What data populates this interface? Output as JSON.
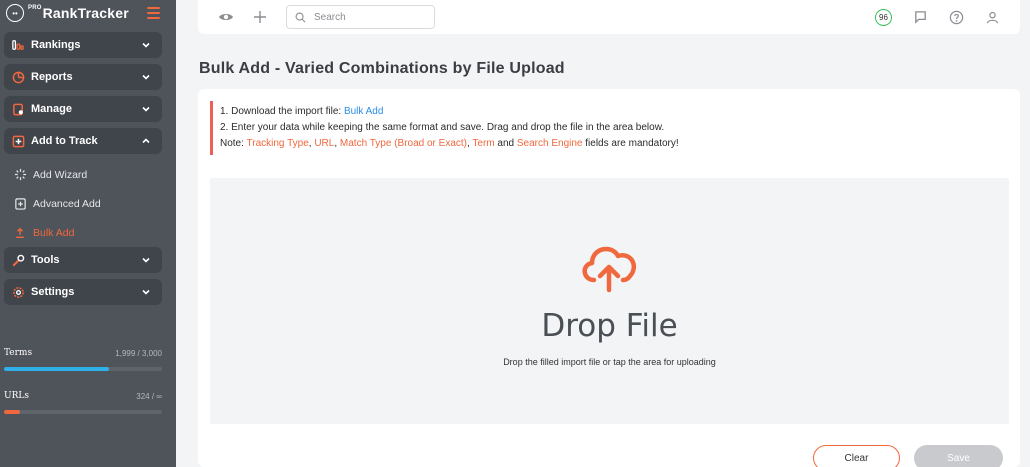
{
  "app": {
    "logo_prefix": "PRO",
    "logo_name": "RankTracker"
  },
  "sidebar": {
    "nav": [
      {
        "label": "Rankings",
        "icon": "rankings-icon"
      },
      {
        "label": "Reports",
        "icon": "pie-chart-icon"
      },
      {
        "label": "Manage",
        "icon": "manage-icon"
      },
      {
        "label": "Add to Track",
        "icon": "add-box-icon"
      }
    ],
    "sub_items": [
      {
        "label": "Add Wizard",
        "icon": "wizard-icon"
      },
      {
        "label": "Advanced Add",
        "icon": "advanced-add-icon"
      },
      {
        "label": "Bulk Add",
        "icon": "upload-icon"
      }
    ],
    "nav_bottom": [
      {
        "label": "Tools",
        "icon": "tools-icon"
      },
      {
        "label": "Settings",
        "icon": "gear-icon"
      }
    ],
    "usage": {
      "terms_label": "Terms",
      "terms_value": "1,999 / 3,000",
      "terms_fraction": 0.666,
      "urls_label": "URLs",
      "urls_value": "324 / ∞",
      "urls_fraction": 0.1
    }
  },
  "topbar": {
    "search_placeholder": "Search",
    "score": "96"
  },
  "page": {
    "title": "Bulk Add - Varied Combinations by File Upload"
  },
  "instructions": {
    "line1_prefix": "1. Download the import file: ",
    "line1_link": "Bulk Add",
    "line2": "2. Enter your data while keeping the same format and save. Drag and drop the file in the area below.",
    "note_prefix": "Note: ",
    "field1": "Tracking Type",
    "sep1": ", ",
    "field2": "URL",
    "sep2": ", ",
    "field3": "Match Type (Broad or Exact)",
    "sep3": ", ",
    "field4": "Term",
    "and": " and ",
    "field5": "Search Engine",
    "note_suffix": " fields are mandatory!"
  },
  "dropzone": {
    "title": "Drop File",
    "subtitle": "Drop the filled import file or tap the area for uploading"
  },
  "actions": {
    "clear_label": "Clear",
    "save_label": "Save"
  },
  "colors": {
    "accent": "#f0683e",
    "sidebar_bg": "#4f535a",
    "terms_bar": "#2fb0e8",
    "urls_bar": "#f0683e",
    "link": "#2a8ee6",
    "score_ring": "#3cbf5a"
  }
}
